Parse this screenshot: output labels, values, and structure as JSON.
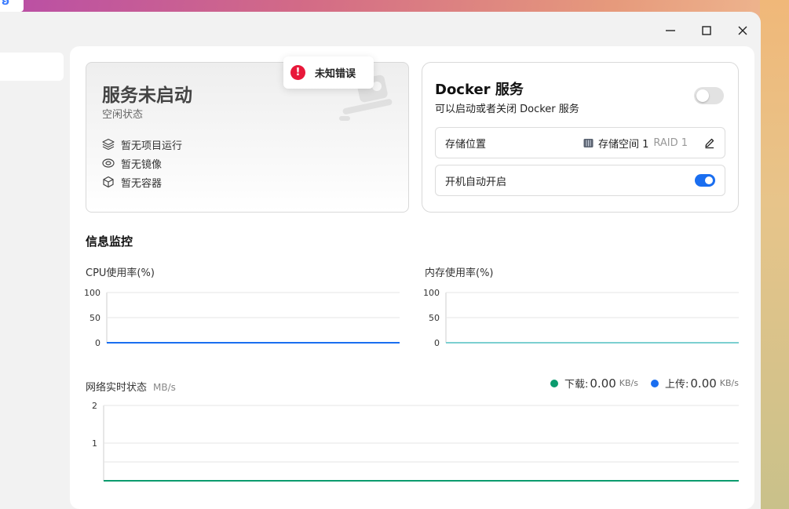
{
  "colors": {
    "accent": "#1a6ef0",
    "error": "#e8183a",
    "download_green": "#0b9b6e",
    "upload_blue": "#1a6ef0",
    "mem_line": "#7ccfd0"
  },
  "toast": {
    "text": "未知错误",
    "icon": "error-icon"
  },
  "status_card": {
    "title": "服务未启动",
    "subtitle": "空闲状态",
    "items": [
      {
        "icon": "layers-icon",
        "label": "暂无项目运行"
      },
      {
        "icon": "disc-icon",
        "label": "暂无镜像"
      },
      {
        "icon": "cube-icon",
        "label": "暂无容器"
      }
    ]
  },
  "docker_card": {
    "title": "Docker 服务",
    "subtitle": "可以启动或者关闭 Docker 服务",
    "service_enabled": false,
    "storage": {
      "label": "存储位置",
      "value": "存储空间 1",
      "raid": "RAID 1"
    },
    "autostart": {
      "label": "开机自动开启",
      "enabled": true
    }
  },
  "monitor": {
    "title": "信息监控",
    "cpu_label": "CPU使用率(%)",
    "mem_label": "内存使用率(%)",
    "network": {
      "title": "网络实时状态",
      "unit": "MB/s",
      "download_label": "下载:",
      "download_value": "0.00",
      "download_unit": "KB/s",
      "upload_label": "上传:",
      "upload_value": "0.00",
      "upload_unit": "KB/s"
    }
  },
  "chart_data": [
    {
      "type": "line",
      "title": "CPU使用率(%)",
      "ylim": [
        0,
        100
      ],
      "yticks": [
        "100",
        "50",
        "0"
      ],
      "series": [
        {
          "values": [
            0,
            0,
            0,
            0,
            0,
            0,
            0,
            0,
            0,
            0
          ]
        }
      ]
    },
    {
      "type": "line",
      "title": "内存使用率(%)",
      "ylim": [
        0,
        100
      ],
      "yticks": [
        "100",
        "50",
        "0"
      ],
      "series": [
        {
          "values": [
            0,
            0,
            0,
            0,
            0,
            0,
            0,
            0,
            0,
            0
          ]
        }
      ]
    },
    {
      "type": "line",
      "title": "网络实时状态",
      "ylim": [
        0,
        2
      ],
      "yticks": [
        "2",
        "1"
      ],
      "series": [
        {
          "name": "下载",
          "values": [
            0,
            0,
            0,
            0,
            0,
            0,
            0,
            0,
            0,
            0
          ]
        },
        {
          "name": "上传",
          "values": [
            0,
            0,
            0,
            0,
            0,
            0,
            0,
            0,
            0,
            0
          ]
        }
      ]
    }
  ]
}
